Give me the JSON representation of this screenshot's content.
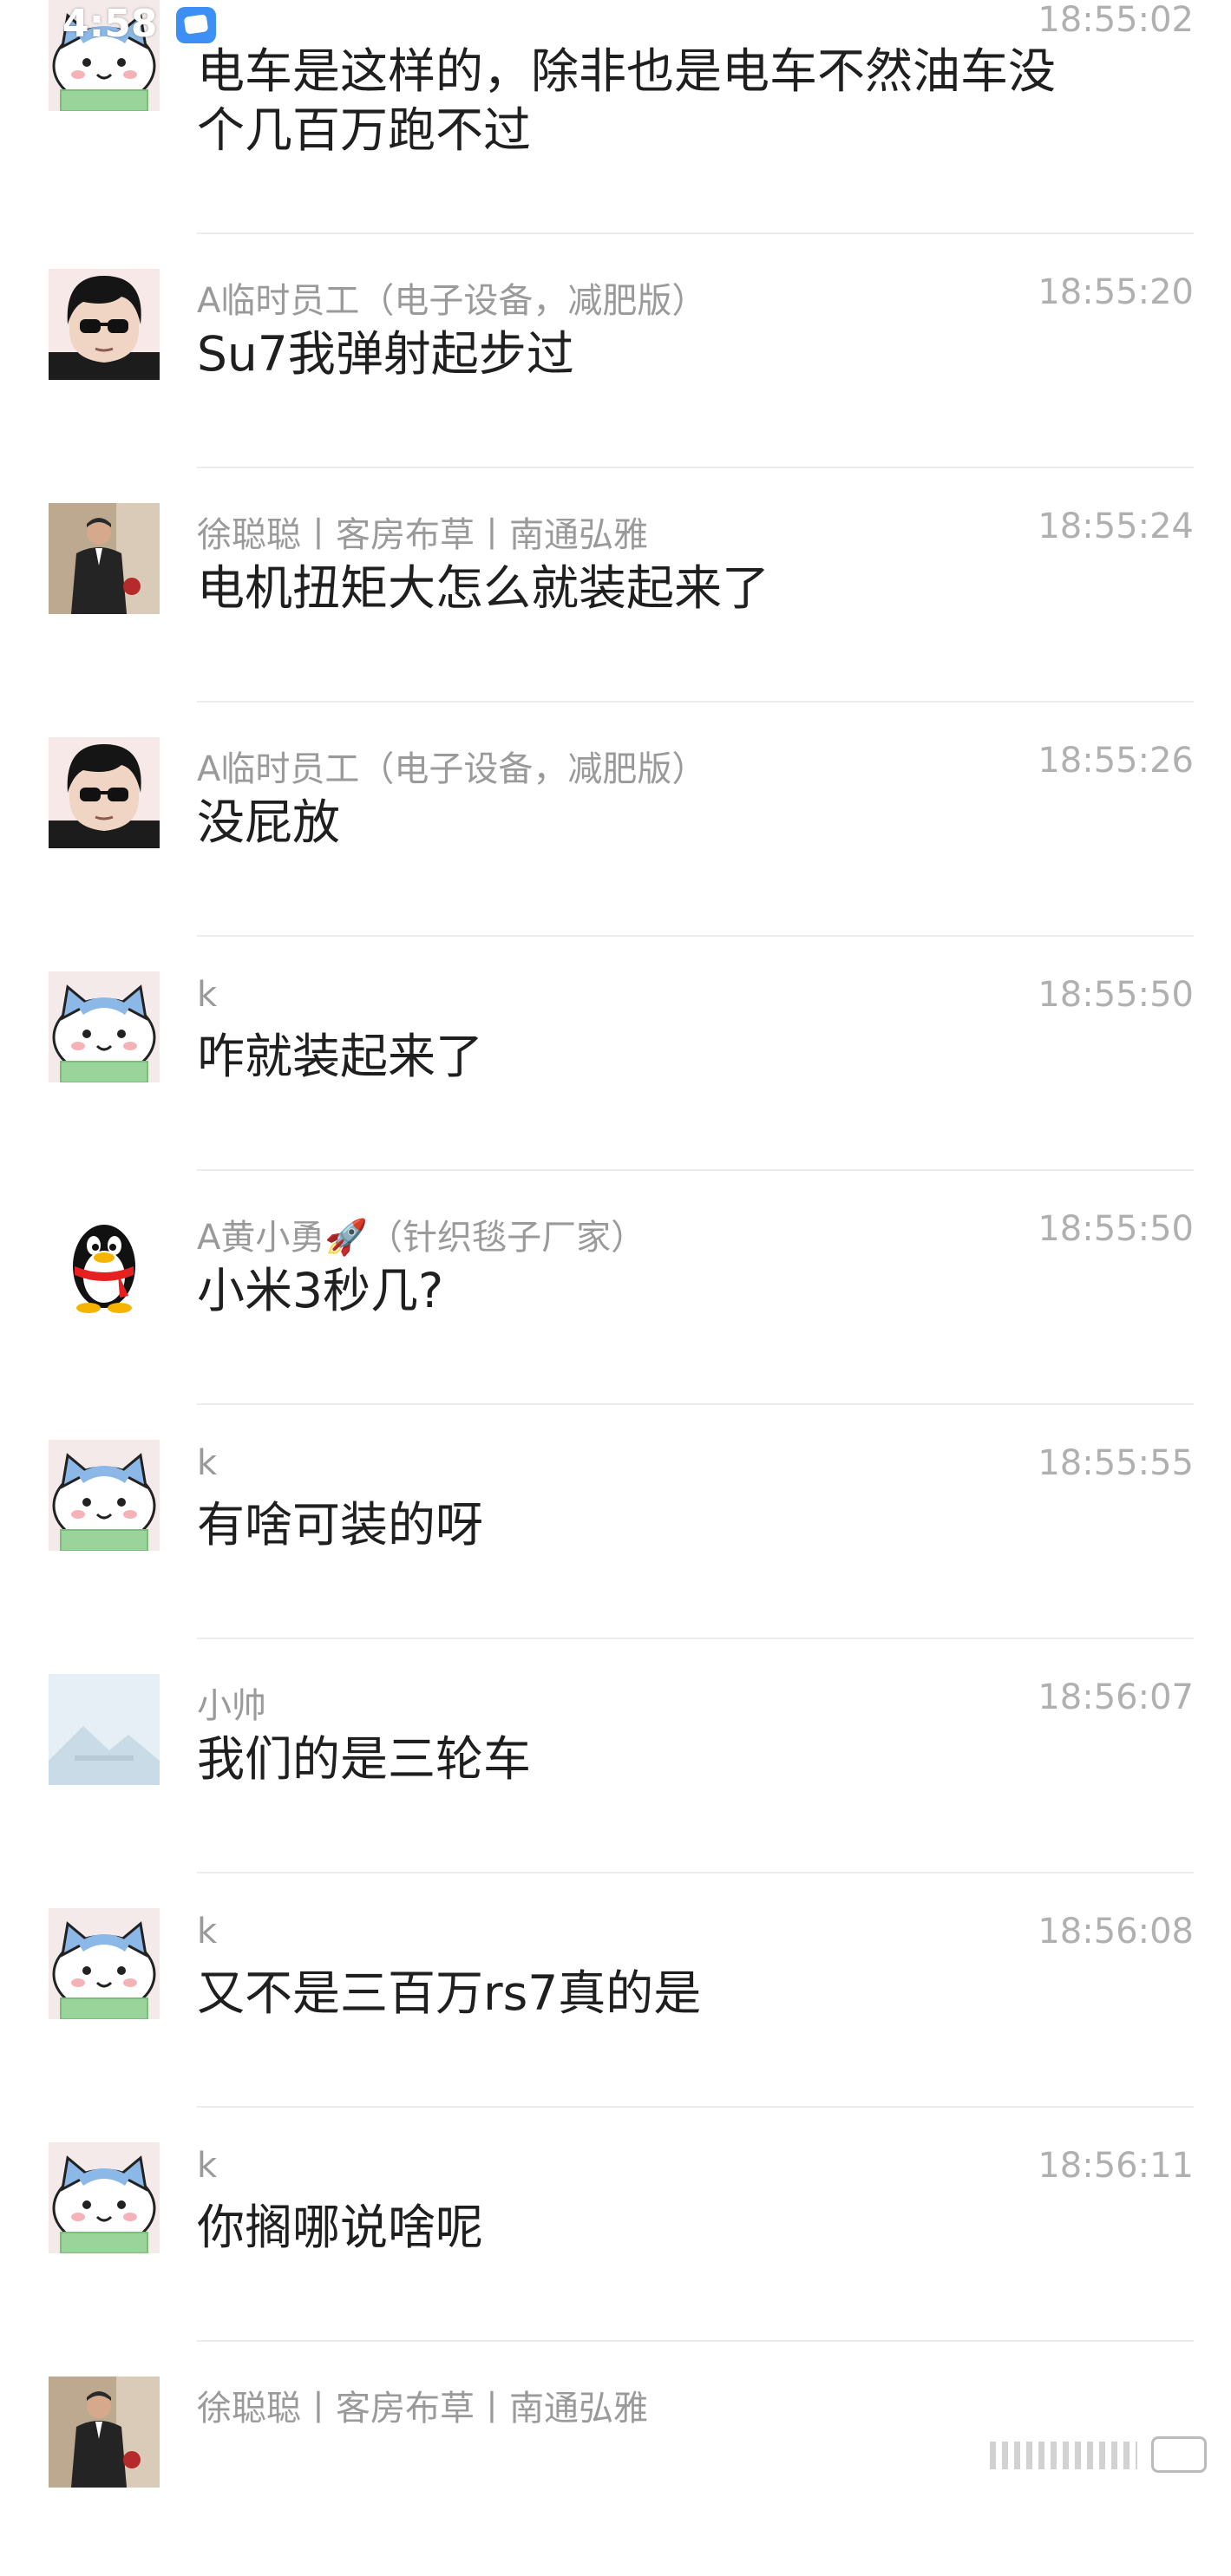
{
  "status_bar": {
    "time": "4:58",
    "app_icon": "chat-bubble-icon"
  },
  "messages": [
    {
      "avatar": "cat-avatar",
      "sender": "",
      "time": "18:55:02",
      "lines": [
        "电车是这样的，除非也是电车不然油车没",
        "个几百万跑不过"
      ]
    },
    {
      "avatar": "sunglasses-avatar",
      "sender": "A临时员工（电子设备，减肥版）",
      "time": "18:55:20",
      "lines": [
        "Su7我弹射起步过"
      ]
    },
    {
      "avatar": "photo-person-avatar",
      "sender": "徐聪聪丨客房布草丨南通弘雅",
      "time": "18:55:24",
      "lines": [
        "电机扭矩大怎么就装起来了"
      ]
    },
    {
      "avatar": "sunglasses-avatar",
      "sender": "A临时员工（电子设备，减肥版）",
      "time": "18:55:26",
      "lines": [
        "没屁放"
      ]
    },
    {
      "avatar": "cat-avatar",
      "sender": "k",
      "time": "18:55:50",
      "lines": [
        "咋就装起来了"
      ]
    },
    {
      "avatar": "penguin-avatar",
      "sender": "A黄小勇🚀（针织毯子厂家）",
      "time": "18:55:50",
      "lines": [
        "小米3秒几?"
      ]
    },
    {
      "avatar": "cat-avatar",
      "sender": "k",
      "time": "18:55:55",
      "lines": [
        "有啥可装的呀"
      ]
    },
    {
      "avatar": "placeholder-avatar",
      "sender": "小帅",
      "time": "18:56:07",
      "lines": [
        "我们的是三轮车"
      ]
    },
    {
      "avatar": "cat-avatar",
      "sender": "k",
      "time": "18:56:08",
      "lines": [
        "又不是三百万rs7真的是"
      ]
    },
    {
      "avatar": "cat-avatar",
      "sender": "k",
      "time": "18:56:11",
      "lines": [
        "你搁哪说啥呢"
      ]
    },
    {
      "avatar": "photo-person-avatar",
      "sender": "徐聪聪丨客房布草丨南通弘雅",
      "time": "",
      "lines": []
    }
  ],
  "colors": {
    "background": "#ffffff",
    "message_text": "#1f1f1f",
    "sender_text": "#9a9a9a",
    "time_text": "#b0b0b0",
    "divider": "#ececec"
  }
}
